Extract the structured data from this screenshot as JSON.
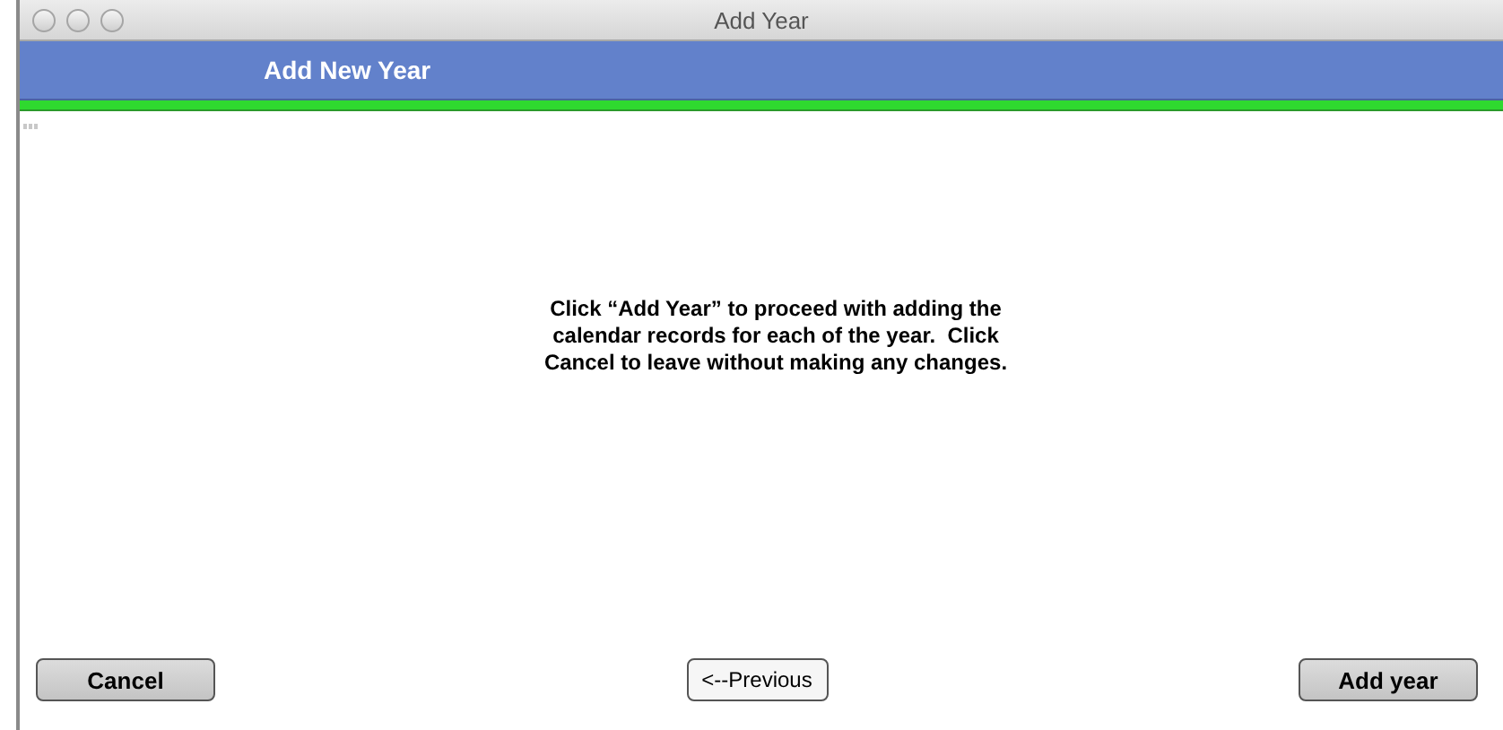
{
  "window": {
    "title": "Add Year"
  },
  "header": {
    "title": "Add New Year"
  },
  "message": "Click “Add Year” to proceed with adding the calendar records for each of the year.  Click Cancel to leave without making any changes.",
  "buttons": [
    {
      "label": "Cancel",
      "kind": "bevel"
    },
    {
      "label": "<--Previous",
      "kind": "plain"
    },
    {
      "label": "Add year",
      "kind": "bevel"
    }
  ]
}
